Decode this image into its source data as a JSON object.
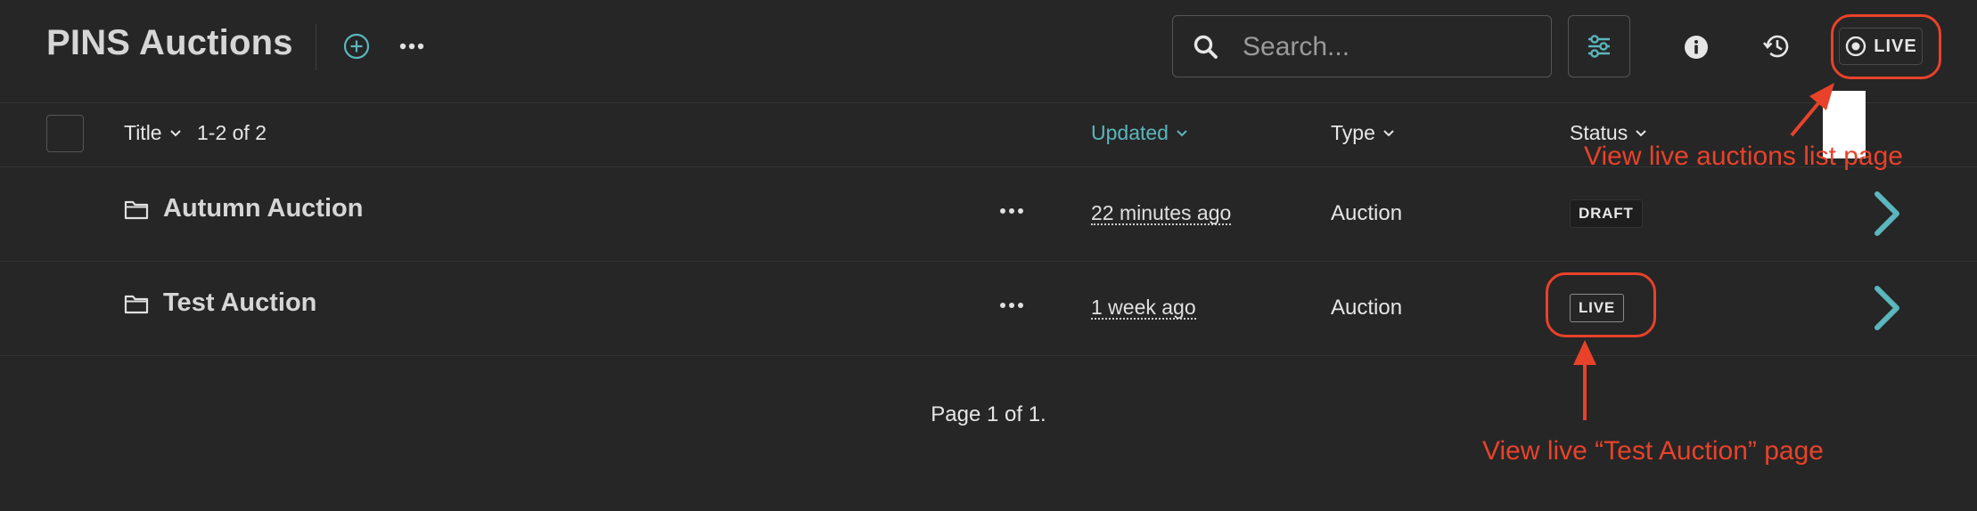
{
  "header": {
    "app_title": "PINS Auctions",
    "search_placeholder": "Search...",
    "search_value": "",
    "live_label": "LIVE"
  },
  "columns": {
    "title": "Title",
    "count": "1-2 of 2",
    "updated": "Updated",
    "type": "Type",
    "status": "Status"
  },
  "rows": [
    {
      "title": "Autumn Auction",
      "updated": "22 minutes ago",
      "type": "Auction",
      "status": "DRAFT"
    },
    {
      "title": "Test Auction",
      "updated": "1 week ago",
      "type": "Auction",
      "status": "LIVE"
    }
  ],
  "pagination": "Page 1 of 1.",
  "annotations": {
    "live_list": "View live auctions list page",
    "live_item": "View live “Test Auction” page"
  },
  "colors": {
    "background": "#262626",
    "accent_teal": "#5bb6bd",
    "annotation_red": "#e8422a"
  },
  "icons": [
    "plus-circle-icon",
    "ellipsis-icon",
    "search-icon",
    "sliders-icon",
    "info-icon",
    "history-icon",
    "eye-icon",
    "chevron-down-icon",
    "folder-icon",
    "chevron-right-icon"
  ]
}
